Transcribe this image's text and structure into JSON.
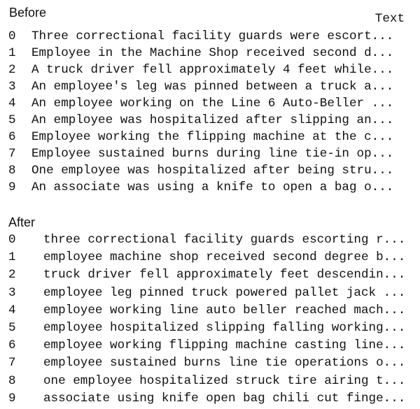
{
  "before": {
    "label": "Before",
    "column_header": "Text",
    "rows": [
      {
        "index": "0",
        "text": "Three correctional facility guards were escort..."
      },
      {
        "index": "1",
        "text": "Employee in the Machine Shop received second d..."
      },
      {
        "index": "2",
        "text": "A truck driver fell approximately 4 feet while..."
      },
      {
        "index": "3",
        "text": "An employee's leg was pinned between a truck a..."
      },
      {
        "index": "4",
        "text": "An employee working on the Line 6 Auto-Beller ..."
      },
      {
        "index": "5",
        "text": "An employee was hospitalized after slipping an..."
      },
      {
        "index": "6",
        "text": "Employee working the flipping machine at the c..."
      },
      {
        "index": "7",
        "text": "Employee sustained burns during line tie-in op..."
      },
      {
        "index": "8",
        "text": "One employee was hospitalized after being stru..."
      },
      {
        "index": "9",
        "text": "An associate was using a knife to open a bag o..."
      }
    ]
  },
  "after": {
    "label": "After",
    "rows": [
      {
        "index": "0",
        "text": "three correctional facility guards escorting r..."
      },
      {
        "index": "1",
        "text": "employee machine shop received second degree b..."
      },
      {
        "index": "2",
        "text": "truck driver fell approximately feet descendin..."
      },
      {
        "index": "3",
        "text": "employee leg pinned truck powered pallet jack ..."
      },
      {
        "index": "4",
        "text": "employee working line auto beller reached mach..."
      },
      {
        "index": "5",
        "text": "employee hospitalized slipping falling working..."
      },
      {
        "index": "6",
        "text": "employee working flipping machine casting line..."
      },
      {
        "index": "7",
        "text": "employee sustained burns line tie operations o..."
      },
      {
        "index": "8",
        "text": "one employee hospitalized struck tire airing t..."
      },
      {
        "index": "9",
        "text": "associate using knife open bag chili cut finge..."
      }
    ]
  }
}
